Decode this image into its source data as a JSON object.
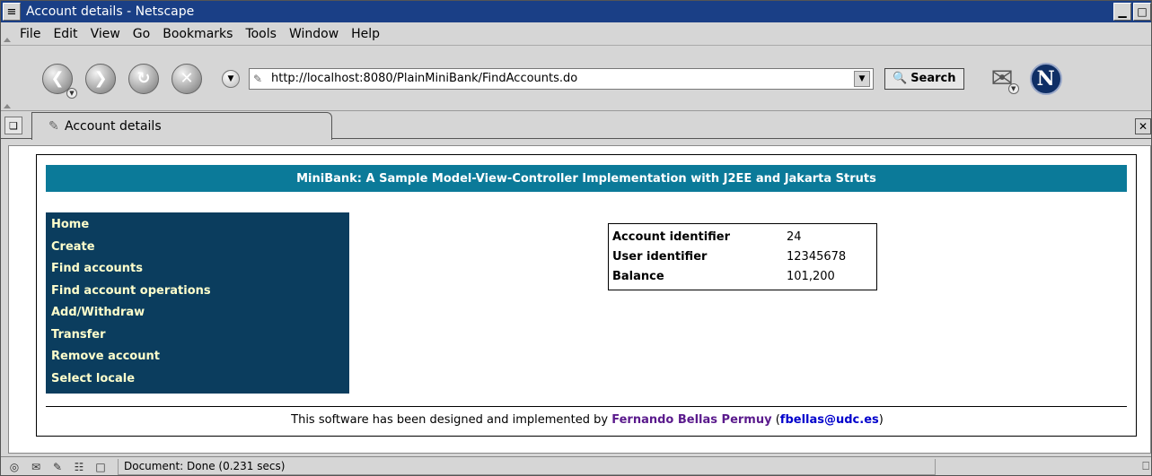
{
  "window": {
    "title": "Account details - Netscape"
  },
  "menubar": {
    "items": [
      {
        "label": "File"
      },
      {
        "label": "Edit"
      },
      {
        "label": "View"
      },
      {
        "label": "Go"
      },
      {
        "label": "Bookmarks"
      },
      {
        "label": "Tools"
      },
      {
        "label": "Window"
      },
      {
        "label": "Help"
      }
    ]
  },
  "toolbar": {
    "url": "http://localhost:8080/PlainMiniBank/FindAccounts.do",
    "search_label": "Search",
    "icons": {
      "back": "back-arrow-icon",
      "forward": "forward-arrow-icon",
      "reload": "reload-icon",
      "stop": "stop-icon",
      "mail": "mail-icon",
      "logo": "netscape-logo-icon"
    }
  },
  "tabs": {
    "active_label": "Account details"
  },
  "page": {
    "banner": "MiniBank: A Sample Model-View-Controller Implementation with J2EE and Jakarta Struts",
    "menu": [
      {
        "label": "Home"
      },
      {
        "label": "Create"
      },
      {
        "label": "Find accounts"
      },
      {
        "label": "Find account operations"
      },
      {
        "label": "Add/Withdraw"
      },
      {
        "label": "Transfer"
      },
      {
        "label": "Remove account"
      },
      {
        "label": "Select locale"
      }
    ],
    "account": {
      "rows": [
        {
          "key": "Account identifier",
          "value": "24"
        },
        {
          "key": "User identifier",
          "value": "12345678"
        },
        {
          "key": "Balance",
          "value": "101,200"
        }
      ]
    },
    "footer": {
      "prefix": "This software has been designed and implemented by",
      "author": "Fernando Bellas Permuy",
      "open_paren": "(",
      "email": "fbellas@udc.es",
      "close_paren": ")"
    }
  },
  "statusbar": {
    "text": "Document: Done (0.231 secs)"
  },
  "colors": {
    "titlebar": "#1a3f86",
    "banner": "#0b7a99",
    "sidemenu": "#0b3d5e",
    "sidemenu_text": "#ffffcc",
    "author_link": "#5a1a8c",
    "email_link": "#0000cc"
  }
}
